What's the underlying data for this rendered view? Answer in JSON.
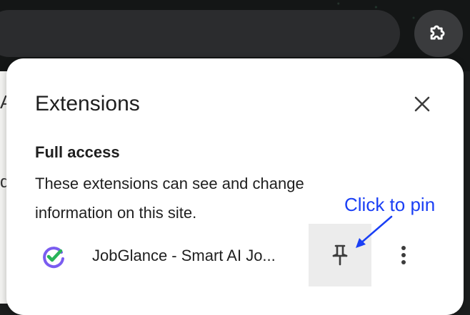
{
  "toolbar": {
    "extensions_button_icon": "puzzle-piece-icon"
  },
  "popup": {
    "title": "Extensions",
    "close_icon": "close-icon",
    "section": {
      "heading": "Full access",
      "description": "These extensions can see and change information on this site."
    },
    "extensions": [
      {
        "name": "JobGlance - Smart AI Jo...",
        "icon": "jobglance-logo-icon",
        "pin_icon": "pin-icon",
        "menu_icon": "more-vert-icon"
      }
    ]
  },
  "annotation": {
    "text": "Click to pin",
    "color": "#1a3ff5"
  },
  "colors": {
    "popup_bg": "#ffffff",
    "chrome_bg": "#141616",
    "pin_button_bg": "#ececec",
    "text": "#1f1f1f"
  }
}
